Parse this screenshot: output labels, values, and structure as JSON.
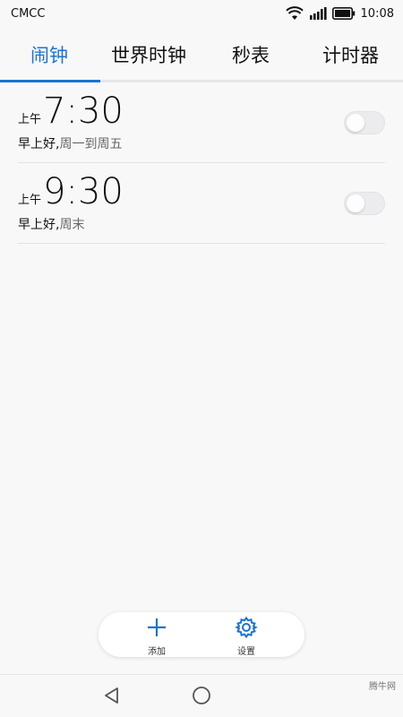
{
  "status_bar": {
    "carrier": "CMCC",
    "time": "10:08"
  },
  "tabs": [
    {
      "label": "闹钟",
      "active": true
    },
    {
      "label": "世界时钟",
      "active": false
    },
    {
      "label": "秒表",
      "active": false
    },
    {
      "label": "计时器",
      "active": false
    }
  ],
  "alarms": [
    {
      "period": "上午",
      "time": "7:30",
      "name": "早上好",
      "separator": ",",
      "repeat": "周一到周五",
      "enabled": false
    },
    {
      "period": "上午",
      "time": "9:30",
      "name": "早上好",
      "separator": ",",
      "repeat": "周末",
      "enabled": false
    }
  ],
  "actions": {
    "add_label": "添加",
    "settings_label": "设置"
  },
  "colors": {
    "accent": "#1a74d6",
    "background": "#f8f8f9"
  },
  "icons": {
    "wifi": "wifi-icon",
    "signal": "signal-icon",
    "battery": "battery-icon",
    "add": "plus-icon",
    "settings": "gear-icon",
    "back": "back-triangle-icon",
    "home": "home-circle-icon"
  },
  "watermark": "腾牛网"
}
